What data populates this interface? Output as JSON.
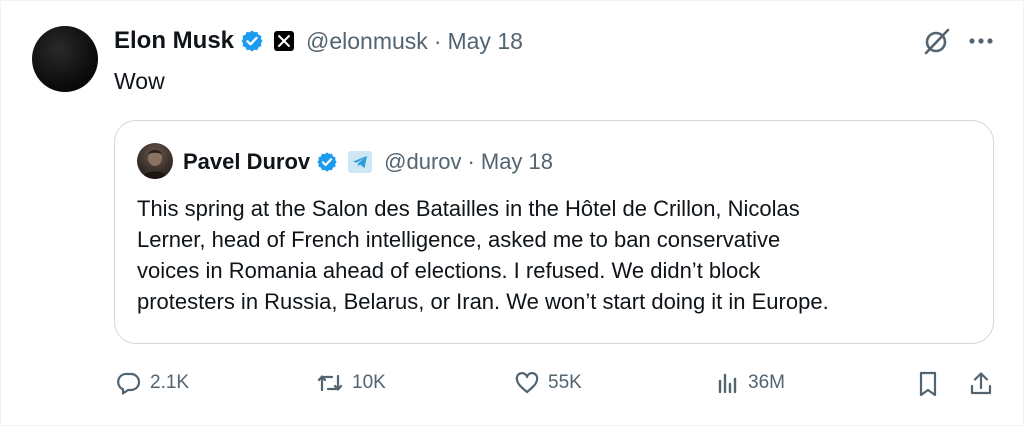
{
  "tweet": {
    "author": {
      "name": "Elon Musk",
      "handle": "@elonmusk",
      "verified": true,
      "affiliation_icon": "x-logo-icon"
    },
    "separator": "·",
    "date": "May 18",
    "text": "Wow"
  },
  "quoted": {
    "author": {
      "name": "Pavel Durov",
      "handle": "@durov",
      "verified": true,
      "affiliation_icon": "telegram-icon"
    },
    "separator": "·",
    "date": "May 18",
    "lines": [
      "This spring at the Salon des Batailles in the Hôtel de Crillon, Nicolas",
      "Lerner, head of French intelligence, asked me to ban conservative",
      "voices in Romania ahead of elections. I refused. We didn’t block",
      "protesters in Russia, Belarus, or Iran. We won’t start doing it in Europe."
    ]
  },
  "actions": {
    "replies": "2.1K",
    "retweets": "10K",
    "likes": "55K",
    "views": "36M"
  },
  "colors": {
    "accent": "#1d9bf0",
    "muted": "#536471",
    "text": "#0f1419",
    "border": "#cfd9de"
  }
}
